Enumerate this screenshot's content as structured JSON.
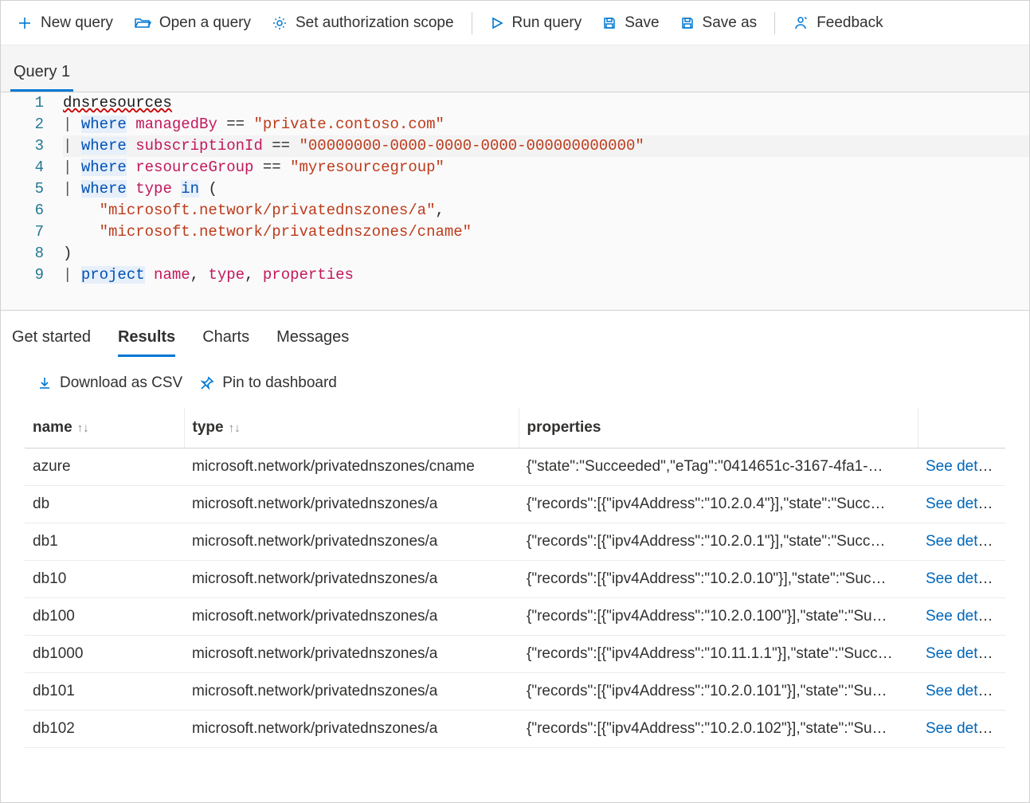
{
  "toolbar": {
    "new_query": "New query",
    "open_query": "Open a query",
    "auth_scope": "Set authorization scope",
    "run_query": "Run query",
    "save": "Save",
    "save_as": "Save as",
    "feedback": "Feedback"
  },
  "query_tabs": {
    "tab1": "Query 1"
  },
  "editor": {
    "lines": [
      "dnsresources",
      "| where managedBy == \"private.contoso.com\"",
      "| where subscriptionId == \"00000000-0000-0000-0000-000000000000\"",
      "| where resourceGroup == \"myresourcegroup\"",
      "| where type in (",
      "    \"microsoft.network/privatednszones/a\",",
      "    \"microsoft.network/privatednszones/cname\"",
      ")",
      "| project name, type, properties"
    ]
  },
  "result_tabs": {
    "get_started": "Get started",
    "results": "Results",
    "charts": "Charts",
    "messages": "Messages"
  },
  "result_actions": {
    "download_csv": "Download as CSV",
    "pin_dashboard": "Pin to dashboard"
  },
  "result_table": {
    "headers": {
      "name": "name",
      "type": "type",
      "properties": "properties"
    },
    "details_label": "See details",
    "rows": [
      {
        "name": "azure",
        "type": "microsoft.network/privatednszones/cname",
        "properties": "{\"state\":\"Succeeded\",\"eTag\":\"0414651c-3167-4fa1-…"
      },
      {
        "name": "db",
        "type": "microsoft.network/privatednszones/a",
        "properties": "{\"records\":[{\"ipv4Address\":\"10.2.0.4\"}],\"state\":\"Succ…"
      },
      {
        "name": "db1",
        "type": "microsoft.network/privatednszones/a",
        "properties": "{\"records\":[{\"ipv4Address\":\"10.2.0.1\"}],\"state\":\"Succ…"
      },
      {
        "name": "db10",
        "type": "microsoft.network/privatednszones/a",
        "properties": "{\"records\":[{\"ipv4Address\":\"10.2.0.10\"}],\"state\":\"Suc…"
      },
      {
        "name": "db100",
        "type": "microsoft.network/privatednszones/a",
        "properties": "{\"records\":[{\"ipv4Address\":\"10.2.0.100\"}],\"state\":\"Su…"
      },
      {
        "name": "db1000",
        "type": "microsoft.network/privatednszones/a",
        "properties": "{\"records\":[{\"ipv4Address\":\"10.11.1.1\"}],\"state\":\"Succ…"
      },
      {
        "name": "db101",
        "type": "microsoft.network/privatednszones/a",
        "properties": "{\"records\":[{\"ipv4Address\":\"10.2.0.101\"}],\"state\":\"Su…"
      },
      {
        "name": "db102",
        "type": "microsoft.network/privatednszones/a",
        "properties": "{\"records\":[{\"ipv4Address\":\"10.2.0.102\"}],\"state\":\"Su…"
      }
    ]
  }
}
